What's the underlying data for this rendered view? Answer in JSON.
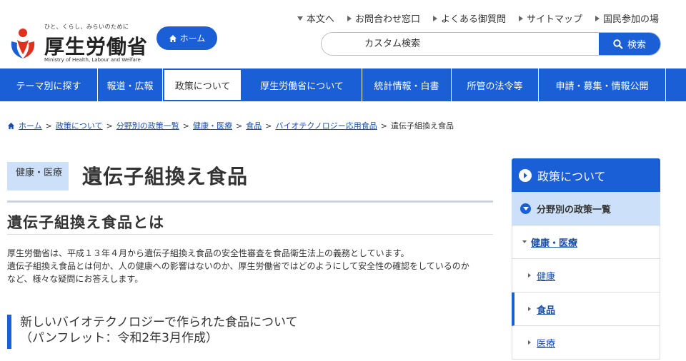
{
  "header": {
    "logo_tagline": "ひと、くらし、みらいのために",
    "logo_name": "厚生労働省",
    "logo_en": "Ministry of Health, Labour and Welfare",
    "home_label": "ホーム",
    "util_links": [
      {
        "label": "本文へ",
        "icon": "triangle-down-icon"
      },
      {
        "label": "お問合わせ窓口",
        "icon": "triangle-right-icon"
      },
      {
        "label": "よくある御質問",
        "icon": "triangle-right-icon"
      },
      {
        "label": "サイトマップ",
        "icon": "triangle-right-icon"
      },
      {
        "label": "国民参加の場",
        "icon": "triangle-right-icon"
      }
    ],
    "search": {
      "placeholder": "カスタム検索",
      "button_label": "検索"
    }
  },
  "gnav": [
    {
      "label": "テーマ別に探す"
    },
    {
      "label": "報道・広報"
    },
    {
      "label": "政策について",
      "active": true
    },
    {
      "label": "厚生労働省について"
    },
    {
      "label": "統計情報・白書"
    },
    {
      "label": "所管の法令等"
    },
    {
      "label": "申請・募集・情報公開"
    }
  ],
  "breadcrumb": {
    "links": [
      "ホーム",
      "政策について",
      "分野別の政策一覧",
      "健康・医療",
      "食品",
      "バイオテクノロジー応用食品"
    ],
    "current": "遺伝子組換え食品"
  },
  "main": {
    "category": "健康・医療",
    "title": "遺伝子組換え食品",
    "h2": "遺伝子組換え食品とは",
    "paragraphs": [
      "厚生労働省は、平成１３年４月から遺伝子組換え食品の安全性審査を食品衛生法上の義務としています。",
      "遺伝子組換え食品とは何か、人の健康への影響はないのか、厚生労働省ではどのようにして安全性の確認をしているのか",
      "など、様々な疑問にお答えします。"
    ],
    "h3_line1": "新しいバイオテクノロジーで作られた食品について",
    "h3_line2": "（パンフレット：令和2年3月作成）"
  },
  "sidebar": {
    "heading": "政策について",
    "sub": "分野別の政策一覧",
    "items": [
      {
        "label": "健康・医療",
        "level": 1
      },
      {
        "label": "健康",
        "level": 2
      },
      {
        "label": "食品",
        "level": 2,
        "current": true
      },
      {
        "label": "医療",
        "level": 2
      }
    ]
  },
  "colors": {
    "brand_blue": "#1a5fd6",
    "light_blue": "#cde0f9"
  }
}
